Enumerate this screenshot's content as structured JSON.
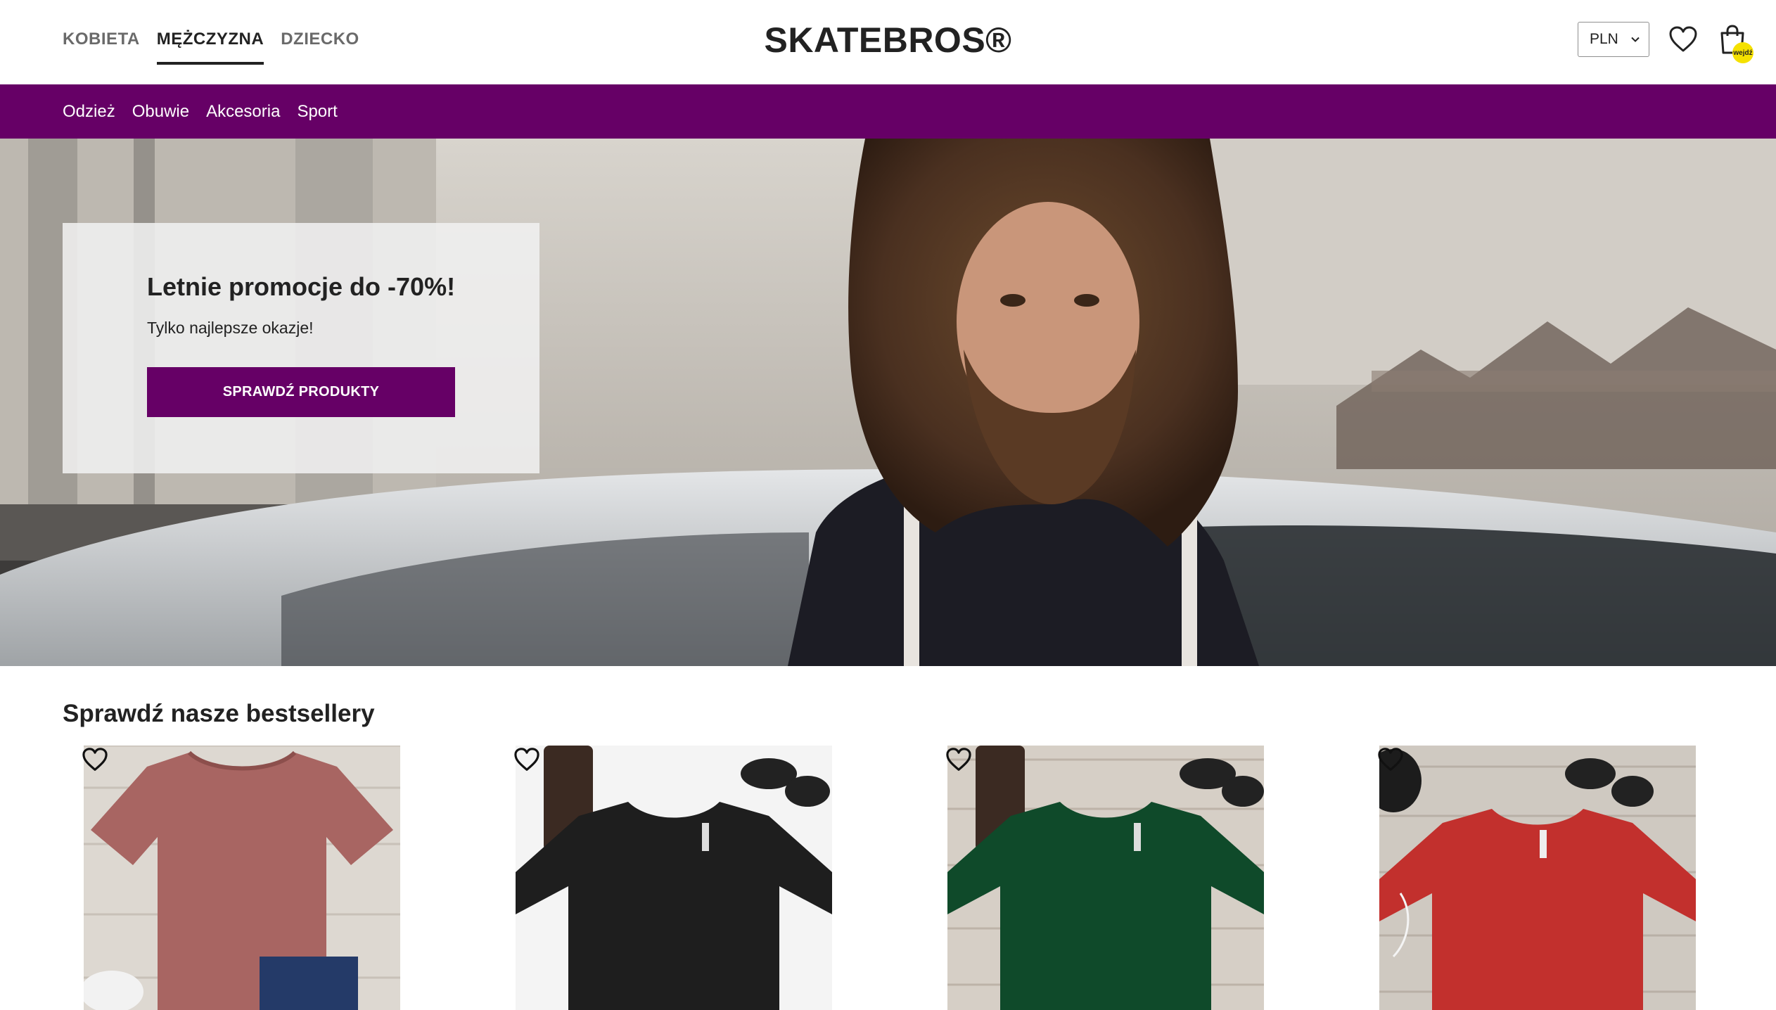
{
  "header": {
    "gender_tabs": [
      {
        "label": "KOBIETA",
        "active": false
      },
      {
        "label": "MĘŻCZYZNA",
        "active": true
      },
      {
        "label": "DZIECKO",
        "active": false
      }
    ],
    "logo": "SKATEBROS®",
    "currency": {
      "selected": "PLN"
    },
    "cart_badge": "wejdź"
  },
  "categories": [
    "Odzież",
    "Obuwie",
    "Akcesoria",
    "Sport"
  ],
  "hero": {
    "title": "Letnie promocje do -70%!",
    "subtitle": "Tylko najlepsze okazje!",
    "button_label": "SPRAWDŹ PRODUKTY"
  },
  "bestsellers": {
    "title": "Sprawdź nasze bestsellery",
    "products": [
      {
        "color": "#a86562",
        "background": "#d9d3cc"
      },
      {
        "color": "#1e1e1e",
        "background": "#f4f4f4"
      },
      {
        "color": "#0f4a2a",
        "background": "#d6cfc6"
      },
      {
        "color": "#c2302d",
        "background": "#cfc9c1"
      }
    ]
  },
  "colors": {
    "brand": "#660066",
    "badge": "#f5e100"
  }
}
